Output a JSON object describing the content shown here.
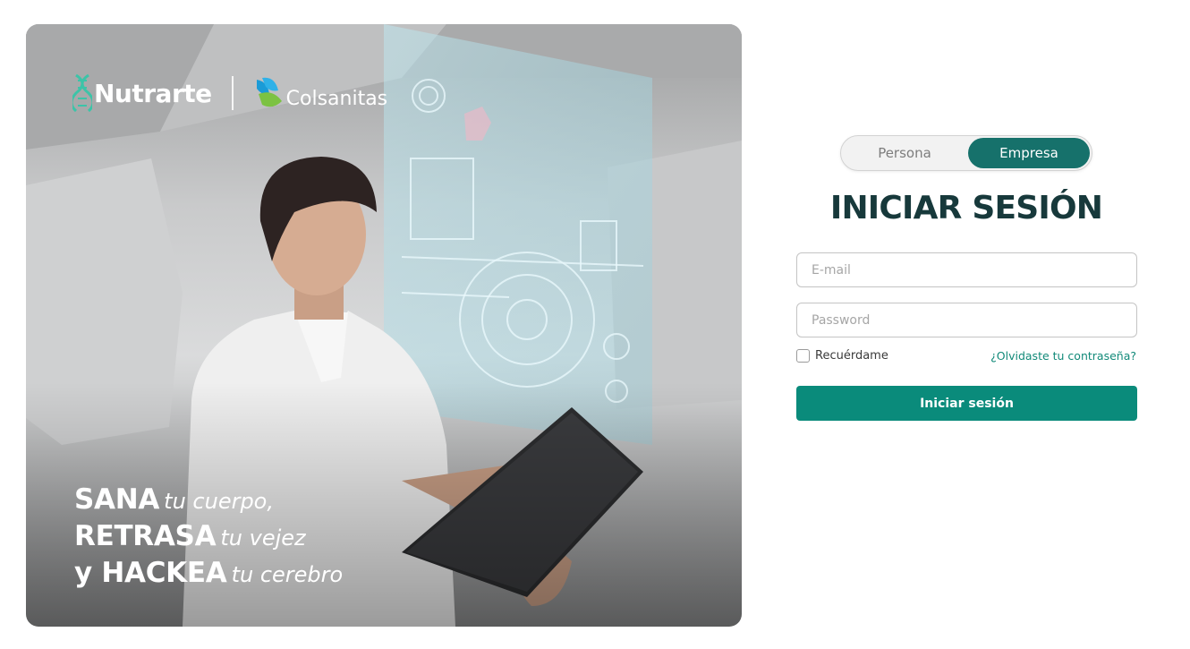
{
  "hero": {
    "logo_nutrarte": "Nutrarte",
    "logo_colsanitas": "Colsanitas",
    "tagline": {
      "line1_strong": "SANA",
      "line1_italic": "tu cuerpo,",
      "line2_strong": "RETRASA",
      "line2_italic": "tu vejez",
      "line3_strong": "y HACKEA",
      "line3_italic": "tu cerebro"
    }
  },
  "login": {
    "toggle": {
      "persona_label": "Persona",
      "empresa_label": "Empresa",
      "selected": "Empresa"
    },
    "title": "INICIAR SESIÓN",
    "email": {
      "placeholder": "E-mail",
      "value": ""
    },
    "password": {
      "placeholder": "Password",
      "value": ""
    },
    "remember_label": "Recuérdame",
    "remember_checked": false,
    "forgot_label": "¿Olvidaste tu contraseña?",
    "submit_label": "Iniciar sesión"
  },
  "colors": {
    "accent": "#0a8b7b",
    "toggle_active": "#16716b",
    "title": "#17393b",
    "link": "#128a79",
    "dna_teal": "#3cc4a8",
    "colsanitas_blue": "#1a9bd7",
    "colsanitas_green": "#7cc242"
  },
  "icons": {
    "nutrarte_logo": "dna-icon",
    "colsanitas_logo": "leaf-icon"
  }
}
